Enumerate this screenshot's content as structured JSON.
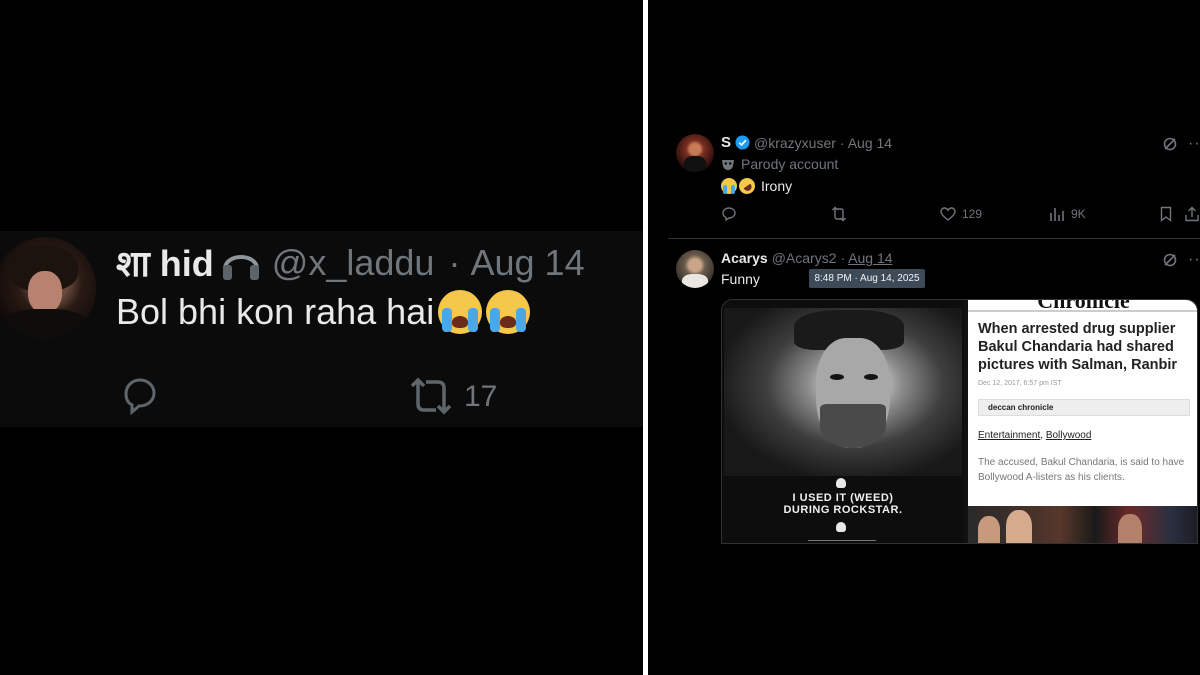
{
  "left_tweet": {
    "name": "शा hid",
    "handle": "@x_laddu",
    "separator": "·",
    "date": "Aug 14",
    "text": "Bol bhi kon raha hai",
    "retweets": "17",
    "icons": [
      "avatar",
      "headphones-icon",
      "reply-icon",
      "retweet-icon",
      "loudly-crying-emoji"
    ]
  },
  "right_tweets": [
    {
      "name": "S",
      "handle": "@krazyxuser",
      "date": "· Aug 14",
      "badge": "Parody account",
      "text": "Irony",
      "stats": {
        "replies": "",
        "retweets": "",
        "likes": "129",
        "views": "9K"
      },
      "icons": [
        "verified-icon",
        "mask-icon",
        "loudly-crying-emoji",
        "rofl-emoji",
        "grok-icon",
        "more-icon",
        "reply-icon",
        "retweet-icon",
        "like-icon",
        "views-icon",
        "bookmark-icon",
        "share-icon"
      ]
    },
    {
      "name": "Acarys",
      "handle": "@Acarys2",
      "separator": "·",
      "date": "Aug 14",
      "text": "Funny",
      "tooltip": "8:48 PM · Aug 14, 2025",
      "media": {
        "quote_line1": "I USED IT (WEED)",
        "quote_line2": "DURING ROCKSTAR.",
        "article": {
          "masthead": "Chronicle",
          "headline": "When arrested drug supplier Bakul Chandaria had shared pictures with Salman, Ranbir",
          "meta": "Dec 12, 2017, 6:57 pm IST",
          "source": "deccan chronicle",
          "category1": "Entertainment",
          "category_sep": ", ",
          "category2": "Bollywood",
          "body": "The accused, Bakul Chandaria, is said to have Bollywood A-listers as his clients."
        }
      }
    }
  ],
  "colors": {
    "background": "#000000",
    "text": "#e7e9ea",
    "muted": "#71767b",
    "verified": "#1d9bf0",
    "divider": "#ffffff"
  }
}
